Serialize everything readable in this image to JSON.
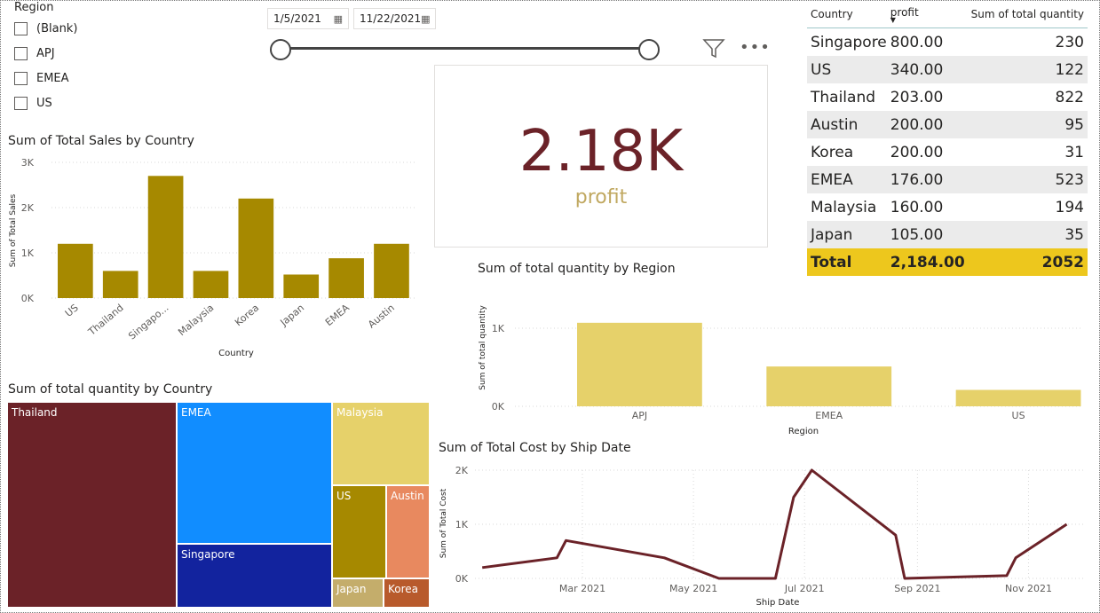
{
  "slicer": {
    "title": "Region",
    "items": [
      "(Blank)",
      "APJ",
      "EMEA",
      "US"
    ]
  },
  "date_slicer": {
    "start": "1/5/2021",
    "end": "11/22/2021",
    "range_fraction": [
      0,
      1
    ]
  },
  "card": {
    "value": "2.18K",
    "label": "profit"
  },
  "table": {
    "headers": [
      "Country",
      "profit",
      "Sum of total quantity"
    ],
    "rows": [
      [
        "Singapore",
        "800.00",
        "230"
      ],
      [
        "US",
        "340.00",
        "122"
      ],
      [
        "Thailand",
        "203.00",
        "822"
      ],
      [
        "Austin",
        "200.00",
        "95"
      ],
      [
        "Korea",
        "200.00",
        "31"
      ],
      [
        "EMEA",
        "176.00",
        "523"
      ],
      [
        "Malaysia",
        "160.00",
        "194"
      ],
      [
        "Japan",
        "105.00",
        "35"
      ]
    ],
    "total": [
      "Total",
      "2,184.00",
      "2052"
    ]
  },
  "colors": {
    "gold_bar": "#a68900",
    "light_gold": "#e6d16a",
    "maroon": "#6b2228",
    "blue": "#118dff",
    "navy": "#12239e",
    "total_row": "#edc71d"
  },
  "chart_data": [
    {
      "type": "bar",
      "title": "Sum of Total Sales by Country",
      "xlabel": "Country",
      "ylabel": "Sum of Total Sales",
      "categories": [
        "US",
        "Thailand",
        "Singapo...",
        "Malaysia",
        "Korea",
        "Japan",
        "EMEA",
        "Austin"
      ],
      "values": [
        1200,
        600,
        2700,
        600,
        2200,
        520,
        880,
        1200
      ],
      "ylim": [
        0,
        3000
      ],
      "yticks": [
        "0K",
        "1K",
        "2K",
        "3K"
      ],
      "grid": true
    },
    {
      "type": "bar",
      "title": "Sum of total quantity by Region",
      "xlabel": "Region",
      "ylabel": "Sum of total quantity",
      "categories": [
        "APJ",
        "EMEA",
        "US"
      ],
      "values": [
        1070,
        510,
        210
      ],
      "ylim": [
        0,
        1000
      ],
      "yticks": [
        "0K",
        "1K"
      ],
      "grid": true
    },
    {
      "type": "line",
      "title": "Sum of Total Cost by Ship Date",
      "xlabel": "Ship Date",
      "ylabel": "Sum of Total Cost",
      "xticks": [
        "Mar 2021",
        "May 2021",
        "Jul 2021",
        "Sep 2021",
        "Nov 2021"
      ],
      "yticks": [
        "0K",
        "1K",
        "2K"
      ],
      "x": [
        "2021-01-05",
        "2021-02-15",
        "2021-02-20",
        "2021-04-15",
        "2021-05-15",
        "2021-06-15",
        "2021-06-25",
        "2021-07-05",
        "2021-08-20",
        "2021-08-25",
        "2021-10-20",
        "2021-10-25",
        "2021-11-22"
      ],
      "y": [
        200,
        380,
        700,
        380,
        0,
        0,
        1500,
        2000,
        800,
        0,
        50,
        380,
        1000
      ],
      "ylim": [
        0,
        2000
      ],
      "grid": true
    },
    {
      "type": "treemap",
      "title": "Sum of total quantity by Country",
      "categories": [
        "Thailand",
        "EMEA",
        "Singapore",
        "Malaysia",
        "US",
        "Austin",
        "Japan",
        "Korea"
      ],
      "values": [
        822,
        523,
        230,
        194,
        122,
        95,
        35,
        31
      ]
    }
  ]
}
